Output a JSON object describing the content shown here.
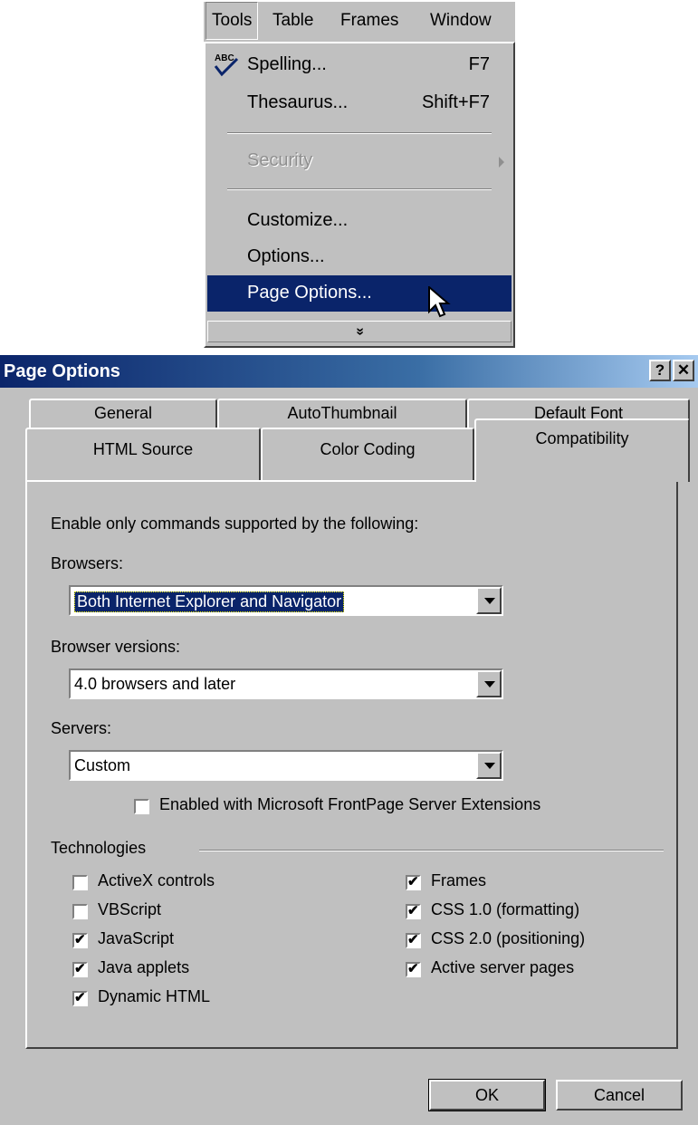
{
  "menubar": {
    "items": [
      {
        "label": "Tools"
      },
      {
        "label": "Table"
      },
      {
        "label": "Frames"
      },
      {
        "label": "Window"
      }
    ]
  },
  "tools_menu": {
    "items": [
      {
        "label": "Spelling...",
        "shortcut": "F7",
        "icon": "spelling-abc-check-icon"
      },
      {
        "label": "Thesaurus...",
        "shortcut": "Shift+F7"
      },
      {
        "label": "Security",
        "disabled": true,
        "submenu": true
      },
      {
        "label": "Customize..."
      },
      {
        "label": "Options..."
      },
      {
        "label": "Page Options...",
        "highlighted": true
      }
    ],
    "expand_icon": "»"
  },
  "dialog": {
    "title": "Page Options",
    "help_label": "?",
    "close_label": "✕",
    "tabs_back": [
      "General",
      "AutoThumbnail",
      "Default Font"
    ],
    "tabs_front": [
      "HTML Source",
      "Color Coding",
      "Compatibility"
    ],
    "active_tab": "Compatibility",
    "intro": "Enable only commands supported by the following:",
    "browsers": {
      "label": "Browsers:",
      "value": "Both Internet Explorer and Navigator"
    },
    "browser_versions": {
      "label": "Browser versions:",
      "value": "4.0 browsers and later"
    },
    "servers": {
      "label": "Servers:",
      "value": "Custom"
    },
    "server_extensions": {
      "label": "Enabled with Microsoft FrontPage Server Extensions",
      "checked": false
    },
    "technologies_label": "Technologies",
    "technologies_left": [
      {
        "label": "ActiveX controls",
        "checked": false
      },
      {
        "label": "VBScript",
        "checked": false
      },
      {
        "label": "JavaScript",
        "checked": true
      },
      {
        "label": "Java applets",
        "checked": true
      },
      {
        "label": "Dynamic HTML",
        "checked": true
      }
    ],
    "technologies_right": [
      {
        "label": "Frames",
        "checked": true
      },
      {
        "label": "CSS 1.0 (formatting)",
        "checked": true
      },
      {
        "label": "CSS 2.0 (positioning)",
        "checked": true
      },
      {
        "label": "Active server pages",
        "checked": true
      }
    ],
    "ok_label": "OK",
    "cancel_label": "Cancel"
  }
}
